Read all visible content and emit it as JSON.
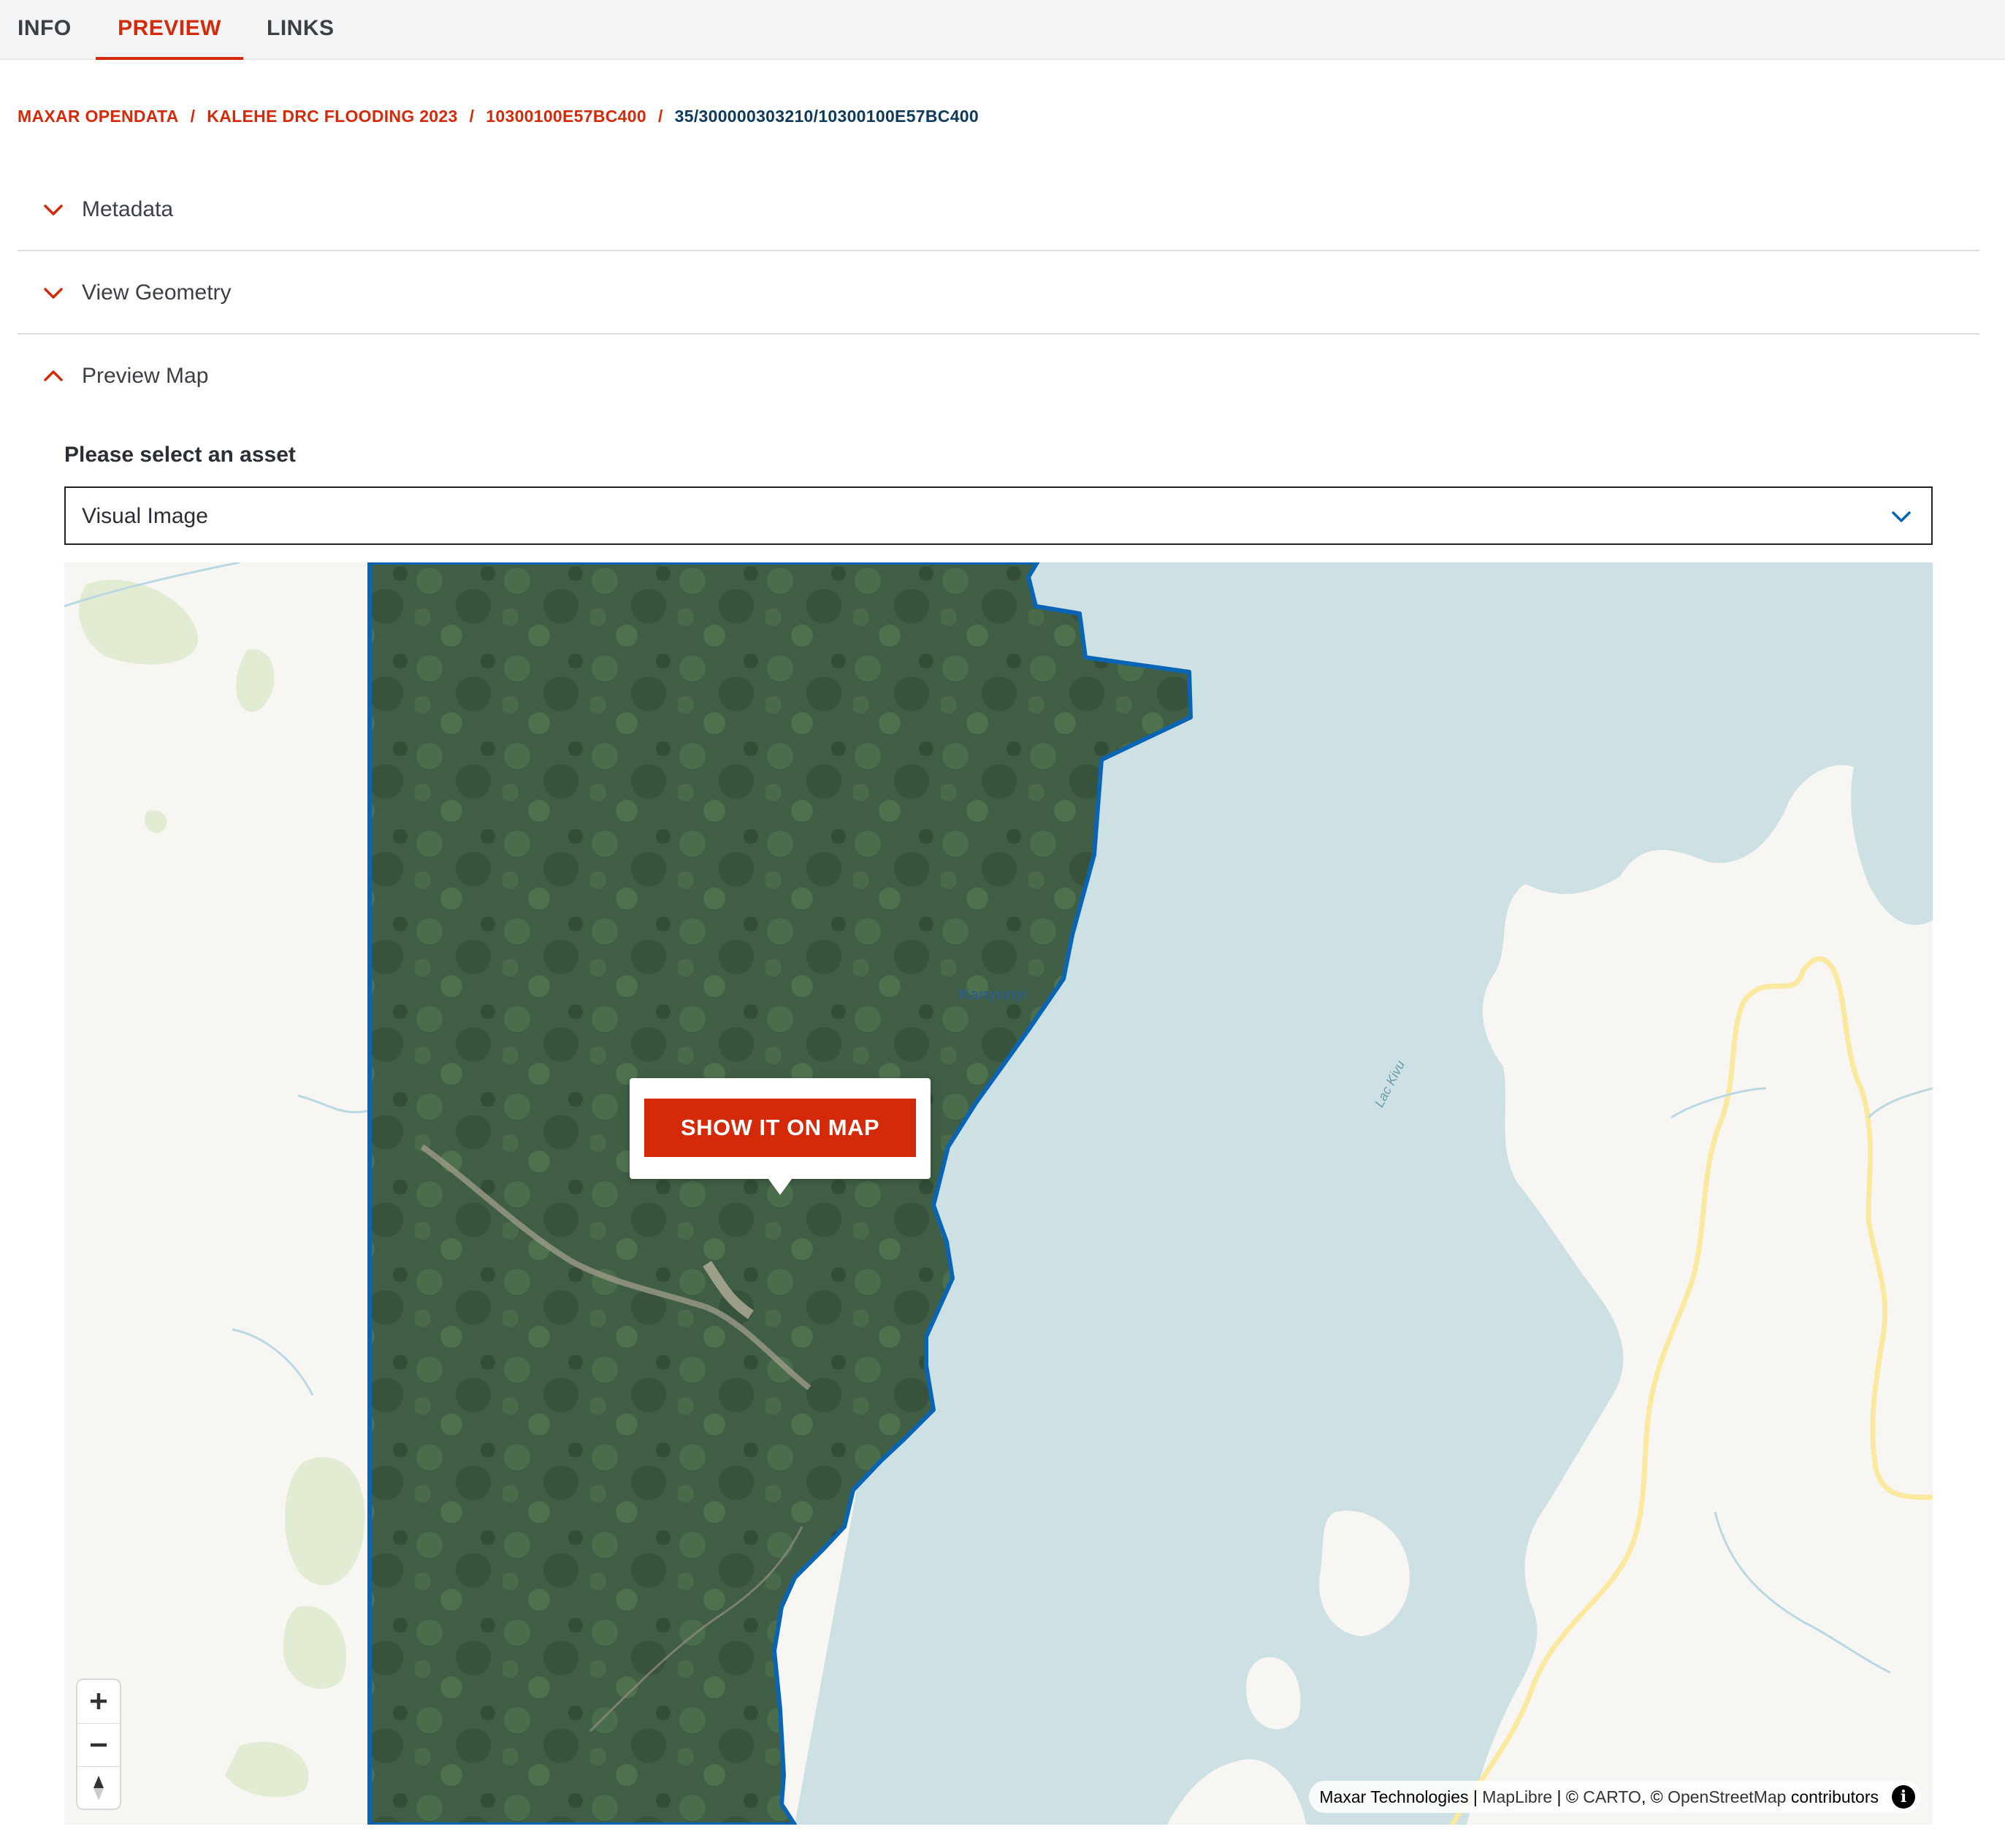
{
  "tabs": [
    {
      "label": "INFO",
      "active": false
    },
    {
      "label": "PREVIEW",
      "active": true
    },
    {
      "label": "LINKS",
      "active": false
    }
  ],
  "breadcrumb": [
    {
      "label": "MAXAR OPENDATA"
    },
    {
      "label": "KALEHE DRC FLOODING 2023"
    },
    {
      "label": "10300100E57BC400"
    },
    {
      "label": "35/300000303210/10300100E57BC400"
    }
  ],
  "breadcrumb_separator": "/",
  "accordion": [
    {
      "label": "Metadata",
      "expanded": false
    },
    {
      "label": "View Geometry",
      "expanded": false
    },
    {
      "label": "Preview Map",
      "expanded": true
    }
  ],
  "asset_select": {
    "label": "Please select an asset",
    "value": "Visual Image"
  },
  "map": {
    "popup_button": "SHOW IT ON MAP",
    "place_label": "Kanyunyi",
    "lake_label": "Lac Kivu",
    "attribution": {
      "maxar": "Maxar Technologies",
      "sep1": " | ",
      "maplibre": "MapLibre",
      "sep2": " | © ",
      "carto": "CARTO",
      "sep3": ", © ",
      "osm": "OpenStreetMap",
      "contributors": " contributors"
    },
    "zoom_in": "+",
    "zoom_out": "−",
    "info_glyph": "i"
  },
  "colors": {
    "accent": "#d42a0a",
    "breadcrumb_current": "#0d3a5c",
    "footprint_outline": "#0a64b4",
    "water": "#cde1e4",
    "land": "#f8f6f2",
    "imagery": "#3f5e44"
  }
}
